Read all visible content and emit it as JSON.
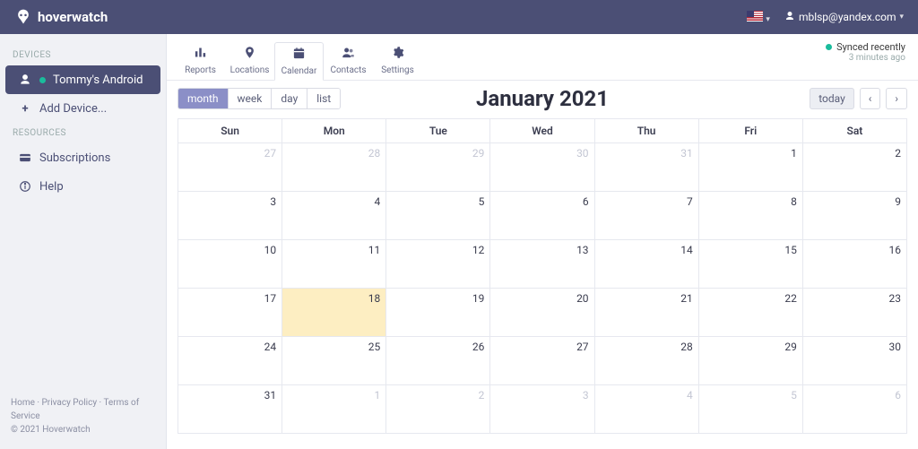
{
  "brand": "hoverwatch",
  "user_email": "mblsp@yandex.com",
  "sidebar": {
    "section_devices": "DEVICES",
    "device_name": "Tommy's Android",
    "add_device": "Add Device...",
    "section_resources": "RESOURCES",
    "subscriptions": "Subscriptions",
    "help": "Help"
  },
  "toolbar": {
    "reports": "Reports",
    "locations": "Locations",
    "calendar": "Calendar",
    "contacts": "Contacts",
    "settings": "Settings"
  },
  "sync": {
    "status": "Synced recently",
    "ago": "3 minutes ago"
  },
  "views": {
    "month": "month",
    "week": "week",
    "day": "day",
    "list": "list"
  },
  "nav": {
    "today": "today"
  },
  "calendar_title": "January 2021",
  "weekdays": [
    "Sun",
    "Mon",
    "Tue",
    "Wed",
    "Thu",
    "Fri",
    "Sat"
  ],
  "weeks": [
    [
      {
        "n": 27,
        "other": true
      },
      {
        "n": 28,
        "other": true
      },
      {
        "n": 29,
        "other": true
      },
      {
        "n": 30,
        "other": true
      },
      {
        "n": 31,
        "other": true
      },
      {
        "n": 1
      },
      {
        "n": 2
      }
    ],
    [
      {
        "n": 3
      },
      {
        "n": 4
      },
      {
        "n": 5
      },
      {
        "n": 6
      },
      {
        "n": 7
      },
      {
        "n": 8
      },
      {
        "n": 9
      }
    ],
    [
      {
        "n": 10
      },
      {
        "n": 11
      },
      {
        "n": 12
      },
      {
        "n": 13
      },
      {
        "n": 14
      },
      {
        "n": 15
      },
      {
        "n": 16
      }
    ],
    [
      {
        "n": 17
      },
      {
        "n": 18,
        "highlight": true
      },
      {
        "n": 19
      },
      {
        "n": 20
      },
      {
        "n": 21
      },
      {
        "n": 22
      },
      {
        "n": 23
      }
    ],
    [
      {
        "n": 24
      },
      {
        "n": 25
      },
      {
        "n": 26
      },
      {
        "n": 27
      },
      {
        "n": 28
      },
      {
        "n": 29
      },
      {
        "n": 30
      }
    ],
    [
      {
        "n": 31
      },
      {
        "n": 1,
        "other": true
      },
      {
        "n": 2,
        "other": true
      },
      {
        "n": 3,
        "other": true
      },
      {
        "n": 4,
        "other": true
      },
      {
        "n": 5,
        "other": true
      },
      {
        "n": 6,
        "other": true
      }
    ]
  ],
  "footer": {
    "home": "Home",
    "privacy": "Privacy Policy",
    "terms": "Terms of Service",
    "copyright": "© 2021 Hoverwatch"
  }
}
